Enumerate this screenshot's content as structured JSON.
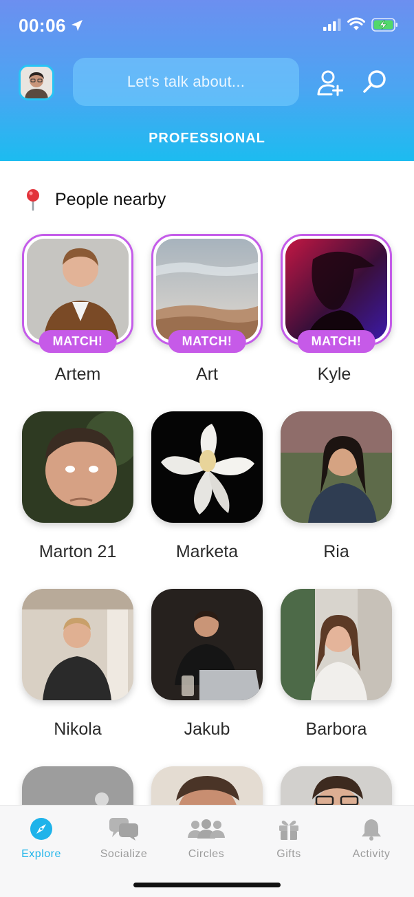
{
  "status_bar": {
    "time": "00:06"
  },
  "header": {
    "search_placeholder": "Let's talk about...",
    "category": "PROFESSIONAL"
  },
  "section": {
    "title": "People nearby"
  },
  "people": [
    {
      "name": "Artem",
      "match": true,
      "badge": "MATCH!"
    },
    {
      "name": "Art",
      "match": true,
      "badge": "MATCH!"
    },
    {
      "name": "Kyle",
      "match": true,
      "badge": "MATCH!"
    },
    {
      "name": "Marton 21",
      "match": false
    },
    {
      "name": "Marketa",
      "match": false
    },
    {
      "name": "Ria",
      "match": false
    },
    {
      "name": "Nikola",
      "match": false
    },
    {
      "name": "Jakub",
      "match": false
    },
    {
      "name": "Barbora",
      "match": false
    }
  ],
  "tabbar": {
    "items": [
      {
        "label": "Explore",
        "icon": "compass-icon",
        "active": true
      },
      {
        "label": "Socialize",
        "icon": "chat-bubbles-icon",
        "active": false
      },
      {
        "label": "Circles",
        "icon": "people-group-icon",
        "active": false
      },
      {
        "label": "Gifts",
        "icon": "gift-icon",
        "active": false
      },
      {
        "label": "Activity",
        "icon": "bell-icon",
        "active": false
      }
    ]
  },
  "colors": {
    "header_top": "#6c8ff0",
    "header_bottom": "#1cbcf0",
    "match_purple": "#c65ae8",
    "active_tab": "#21b5ea"
  }
}
